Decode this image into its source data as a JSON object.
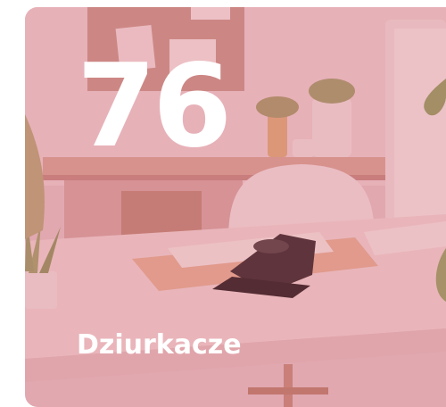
{
  "category_tile": {
    "count": "76",
    "label": "Dziurkacze",
    "image": "office-desk-with-hole-punch",
    "overlay_color": "#d45c6e"
  }
}
